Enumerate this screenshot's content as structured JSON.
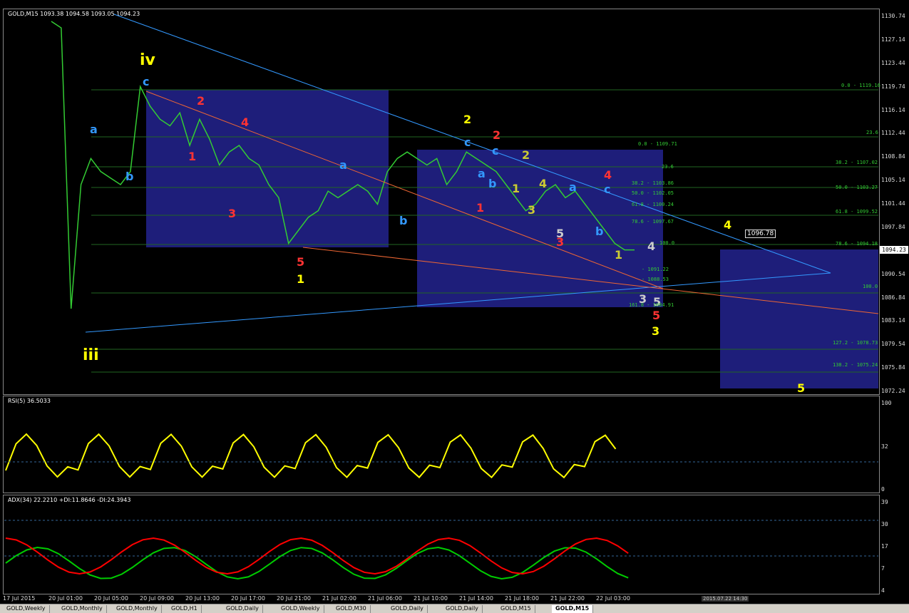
{
  "main": {
    "title": "GOLD,M15  1093.38 1094.58 1093.05 1094.23",
    "current_price": "1094.23",
    "level_box": "1096.78",
    "yaxis_ticks": [
      "1130.74",
      "1127.14",
      "1123.44",
      "1119.74",
      "1116.14",
      "1112.44",
      "1108.84",
      "1105.14",
      "1101.44",
      "1097.84",
      "1094.14",
      "1090.54",
      "1086.84",
      "1083.14",
      "1079.54",
      "1075.84",
      "1072.24"
    ],
    "fib_labels": [
      {
        "t": "0.0 - 1119.16",
        "c": "#3c3"
      },
      {
        "t": "23.6",
        "c": "#3c3"
      },
      {
        "t": "38.2 - 1107.02",
        "c": "#3c3"
      },
      {
        "t": "50.0 - 1103.27",
        "c": "#3c3"
      },
      {
        "t": "61.8 - 1099.52",
        "c": "#3c3"
      },
      {
        "t": "78.6 - 1094.18",
        "c": "#3c3"
      },
      {
        "t": "100.0",
        "c": "#3c3"
      },
      {
        "t": "127.2 - 1078.73",
        "c": "#3c3"
      },
      {
        "t": "138.2 - 1075.24",
        "c": "#3c3"
      },
      {
        "t": "0.0 - 1109.71",
        "c": "#3c3"
      },
      {
        "t": "23.6",
        "c": "#3c3"
      },
      {
        "t": "38.2 - 1103.86",
        "c": "#3c3"
      },
      {
        "t": "50.0 - 1102.05",
        "c": "#3c3"
      },
      {
        "t": "61.8 - 1100.24",
        "c": "#3c3"
      },
      {
        "t": "78.6 - 1097.67",
        "c": "#3c3"
      },
      {
        "t": "100.0",
        "c": "#3c3"
      },
      {
        "t": "- 1091.22",
        "c": "#3c3"
      },
      {
        "t": "- 1088.53",
        "c": "#3c3"
      },
      {
        "t": "161.8 - 1084.91",
        "c": "#3c3"
      }
    ],
    "wave_labels": [
      {
        "t": "iv",
        "c": "#ff0"
      },
      {
        "t": "iii",
        "c": "#ff0"
      },
      {
        "t": "c",
        "c": "#39f"
      },
      {
        "t": "a",
        "c": "#39f"
      },
      {
        "t": "b",
        "c": "#39f"
      },
      {
        "t": "2",
        "c": "#f33"
      },
      {
        "t": "4",
        "c": "#f33"
      },
      {
        "t": "1",
        "c": "#f33"
      },
      {
        "t": "3",
        "c": "#f33"
      },
      {
        "t": "5",
        "c": "#f33"
      },
      {
        "t": "1",
        "c": "#ff0"
      },
      {
        "t": "a",
        "c": "#39f"
      },
      {
        "t": "b",
        "c": "#39f"
      },
      {
        "t": "2",
        "c": "#ff0"
      },
      {
        "t": "c",
        "c": "#39f"
      },
      {
        "t": "a",
        "c": "#39f"
      },
      {
        "t": "b",
        "c": "#39f"
      },
      {
        "t": "2",
        "c": "#f33"
      },
      {
        "t": "c",
        "c": "#39f"
      },
      {
        "t": "1",
        "c": "#f33"
      },
      {
        "t": "2",
        "c": "#cc3"
      },
      {
        "t": "1",
        "c": "#cc3"
      },
      {
        "t": "4",
        "c": "#cc3"
      },
      {
        "t": "3",
        "c": "#cc3"
      },
      {
        "t": "5",
        "c": "#ccc"
      },
      {
        "t": "3",
        "c": "#f33"
      },
      {
        "t": "a",
        "c": "#39f"
      },
      {
        "t": "c",
        "c": "#39f"
      },
      {
        "t": "4",
        "c": "#f33"
      },
      {
        "t": "b",
        "c": "#39f"
      },
      {
        "t": "1",
        "c": "#cc3"
      },
      {
        "t": "4",
        "c": "#ff0"
      },
      {
        "t": "5",
        "c": "#f33"
      },
      {
        "t": "3",
        "c": "#ff0"
      },
      {
        "t": "5",
        "c": "#ff0"
      },
      {
        "t": "3",
        "c": "#ccc"
      },
      {
        "t": "5",
        "c": "#ccc"
      },
      {
        "t": "4",
        "c": "#ccc"
      }
    ]
  },
  "rsi": {
    "title": "RSI(5) 36.5033",
    "yaxis_ticks": [
      "100",
      "32",
      "0"
    ]
  },
  "adx": {
    "title": "ADX(34) 22.2210 +DI:11.8646 -DI:24.3943",
    "yaxis_ticks": [
      "39",
      "30",
      "17",
      "7",
      "4"
    ]
  },
  "xaxis_labels": [
    "17 Jul 2015",
    "20 Jul 01:00",
    "20 Jul 05:00",
    "20 Jul 09:00",
    "20 Jul 13:00",
    "20 Jul 17:00",
    "20 Jul 21:00",
    "21 Jul 02:00",
    "21 Jul 06:00",
    "21 Jul 10:00",
    "21 Jul 14:00",
    "21 Jul 18:00",
    "21 Jul 22:00",
    "22 Jul 03:00"
  ],
  "date_box": "2015.07.22 14:30",
  "tabs": [
    "GOLD,Weekly",
    "GOLD,Monthly",
    "GOLD,Monthly",
    "GOLD,H1",
    "GOLD,Daily",
    "GOLD,Weekly",
    "GOLD,M30",
    "GOLD,Daily",
    "GOLD,Daily",
    "GOLD,M15",
    "GOLD,M15"
  ],
  "colors": {
    "price": "#3c3",
    "rsi": "#ff0",
    "plus_di": "#0c0",
    "minus_di": "#f00",
    "trend": "#39f",
    "zone": "#1e1e7a"
  },
  "chart_data": {
    "type": "line",
    "title": "GOLD,M15",
    "ylim": [
      1072.24,
      1130.74
    ],
    "series": [
      {
        "values": [
          1129,
          1128,
          1085,
          1104,
          1108,
          1106,
          1105,
          1104,
          1106,
          1119,
          1116,
          1114,
          1113,
          1115,
          1110,
          1114,
          1111,
          1107,
          1109,
          1110,
          1108,
          1107,
          1104,
          1102,
          1095,
          1097,
          1099,
          1100,
          1103,
          1102,
          1103,
          1104,
          1103,
          1101,
          1106,
          1108,
          1109,
          1108,
          1107,
          1108,
          1104,
          1106,
          1109,
          1108,
          1107,
          1106,
          1104,
          1102,
          1100,
          1101,
          1103,
          1104,
          1102,
          1103,
          1101,
          1099,
          1097,
          1095,
          1094,
          1094
        ]
      }
    ]
  }
}
